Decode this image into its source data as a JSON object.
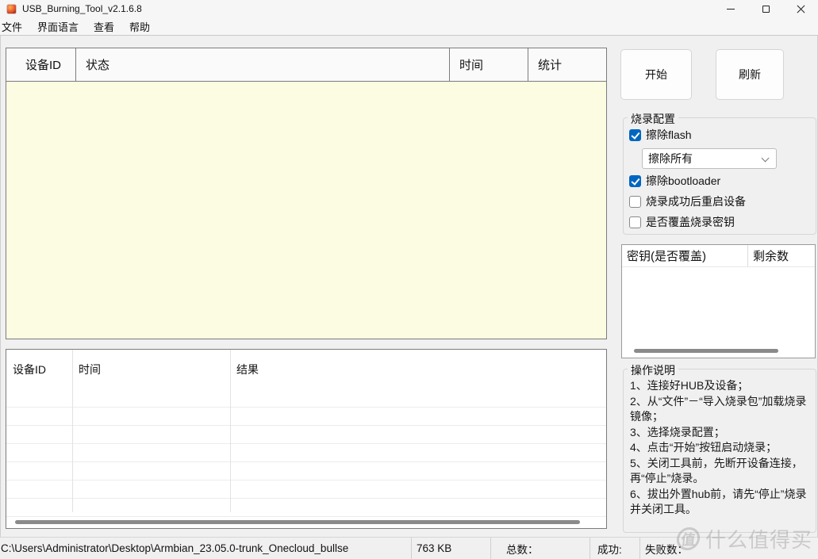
{
  "window": {
    "title": "USB_Burning_Tool_v2.1.6.8"
  },
  "menu": {
    "items": [
      {
        "label": "文件"
      },
      {
        "label": "界面语言"
      },
      {
        "label": "查看"
      },
      {
        "label": "帮助"
      }
    ]
  },
  "device_table": {
    "columns": [
      {
        "label": "设备ID"
      },
      {
        "label": "状态"
      },
      {
        "label": "时间"
      },
      {
        "label": "统计"
      }
    ],
    "rows": []
  },
  "toolbar": {
    "start_label": "开始",
    "refresh_label": "刷新"
  },
  "burn_config": {
    "title": "烧录配置",
    "erase_flash": {
      "label": "擦除flash",
      "checked": true
    },
    "erase_mode": {
      "value": "擦除所有"
    },
    "erase_bootloader": {
      "label": "擦除bootloader",
      "checked": true
    },
    "reboot_after_success": {
      "label": "烧录成功后重启设备",
      "checked": false
    },
    "overwrite_key": {
      "label": "是否覆盖烧录密钥",
      "checked": false
    }
  },
  "key_table": {
    "columns": [
      {
        "label": "密钥(是否覆盖)"
      },
      {
        "label": "剩余数"
      }
    ],
    "rows": []
  },
  "instructions": {
    "title": "操作说明",
    "lines": [
      "1、连接好HUB及设备；",
      "2、从“文件”－“导入烧录包”加载烧录镜像；",
      "3、选择烧录配置；",
      "4、点击“开始”按钮启动烧录；",
      "5、关闭工具前，先断开设备连接，再“停止”烧录。",
      "6、拔出外置hub前，请先“停止”烧录并关闭工具。"
    ]
  },
  "result_table": {
    "columns": [
      {
        "label": "设备ID"
      },
      {
        "label": "时间"
      },
      {
        "label": "结果"
      }
    ],
    "rows": []
  },
  "status_bar": {
    "file_path": "C:\\Users\\Administrator\\Desktop\\Armbian_23.05.0-trunk_Onecloud_bullse",
    "file_size": "763 KB",
    "total_label": "总数：",
    "success_label": "成功:",
    "failed_label": "失败数："
  },
  "watermark": {
    "logo_char": "值",
    "text": "什么值得买"
  },
  "colors": {
    "accent_checkbox": "#0067c0",
    "device_table_bg": "#fcfce2",
    "scrollbar_thumb": "#8a8a8a"
  }
}
